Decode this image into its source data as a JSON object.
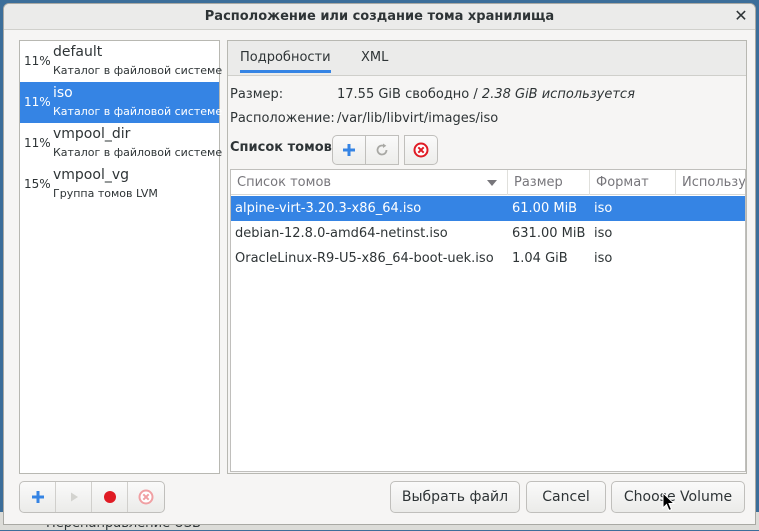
{
  "window": {
    "title": "Расположение или создание тома хранилища",
    "close_glyph": "✕"
  },
  "pools": [
    {
      "pct": "11%",
      "name": "default",
      "type": "Каталог в файловой системе",
      "selected": false
    },
    {
      "pct": "11%",
      "name": "iso",
      "type": "Каталог в файловой системе",
      "selected": true
    },
    {
      "pct": "11%",
      "name": "vmpool_dir",
      "type": "Каталог в файловой системе",
      "selected": false
    },
    {
      "pct": "15%",
      "name": "vmpool_vg",
      "type": "Группа томов LVM",
      "selected": false
    }
  ],
  "tabs": {
    "details": "Подробности",
    "xml": "XML"
  },
  "details": {
    "size_label": "Размер:",
    "size_free": "17.55 GiB свободно",
    "size_sep": " / ",
    "size_used": "2.38 GiB используется",
    "location_label": "Расположение:",
    "location_value": "/var/lib/libvirt/images/iso"
  },
  "volumes": {
    "label": "Список томов",
    "columns": [
      "Список томов",
      "Размер",
      "Формат",
      "Используется"
    ],
    "rows": [
      {
        "name": "alpine-virt-3.20.3-x86_64.iso",
        "size": "61.00 MiB",
        "format": "iso",
        "selected": true
      },
      {
        "name": "debian-12.8.0-amd64-netinst.iso",
        "size": "631.00 MiB",
        "format": "iso",
        "selected": false
      },
      {
        "name": "OracleLinux-R9-U5-x86_64-boot-uek.iso",
        "size": "1.04 GiB",
        "format": "iso",
        "selected": false
      }
    ]
  },
  "buttons": {
    "browse": "Выбрать файл",
    "cancel": "Cancel",
    "choose": "Choose Volume"
  },
  "background": {
    "partial_text": "Перенаправление USB"
  },
  "colors": {
    "accent": "#3584e4",
    "delete": "#e01b24",
    "record": "#e01b24"
  },
  "icons": {
    "volume_add": "plus-icon",
    "volume_refresh": "refresh-icon",
    "volume_delete": "delete-icon",
    "pool_add": "plus-icon",
    "pool_start": "play-icon",
    "pool_stop": "record-icon",
    "pool_delete": "delete-icon"
  }
}
